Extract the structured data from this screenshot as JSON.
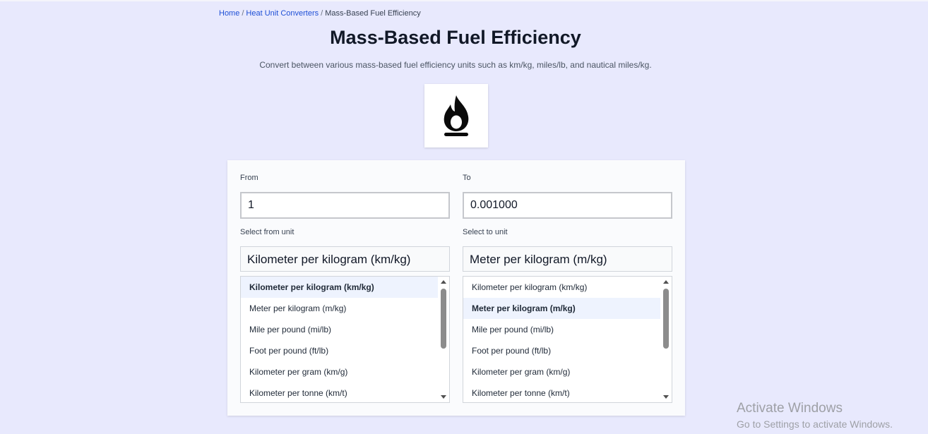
{
  "breadcrumb": {
    "home": "Home",
    "sep1": "/",
    "category": "Heat Unit Converters",
    "sep2": "/",
    "current": "Mass-Based Fuel Efficiency"
  },
  "header": {
    "title": "Mass-Based Fuel Efficiency",
    "subtitle": "Convert between various mass-based fuel efficiency units such as km/kg, miles/lb, and nautical miles/kg.",
    "icon": "flame-icon"
  },
  "converter": {
    "from": {
      "label": "From",
      "value": "1",
      "unit_label": "Select from unit",
      "selected_unit": "Kilometer per kilogram (km/kg)",
      "options": [
        "Kilometer per kilogram (km/kg)",
        "Meter per kilogram (m/kg)",
        "Mile per pound (mi/lb)",
        "Foot per pound (ft/lb)",
        "Kilometer per gram (km/g)",
        "Kilometer per tonne (km/t)"
      ]
    },
    "to": {
      "label": "To",
      "value": "0.001000",
      "unit_label": "Select to unit",
      "selected_unit": "Meter per kilogram (m/kg)",
      "options": [
        "Kilometer per kilogram (km/kg)",
        "Meter per kilogram (m/kg)",
        "Mile per pound (mi/lb)",
        "Foot per pound (ft/lb)",
        "Kilometer per gram (km/g)",
        "Kilometer per tonne (km/t)"
      ]
    }
  },
  "watermark": {
    "line1": "Activate Windows",
    "line2": "Go to Settings to activate Windows."
  }
}
